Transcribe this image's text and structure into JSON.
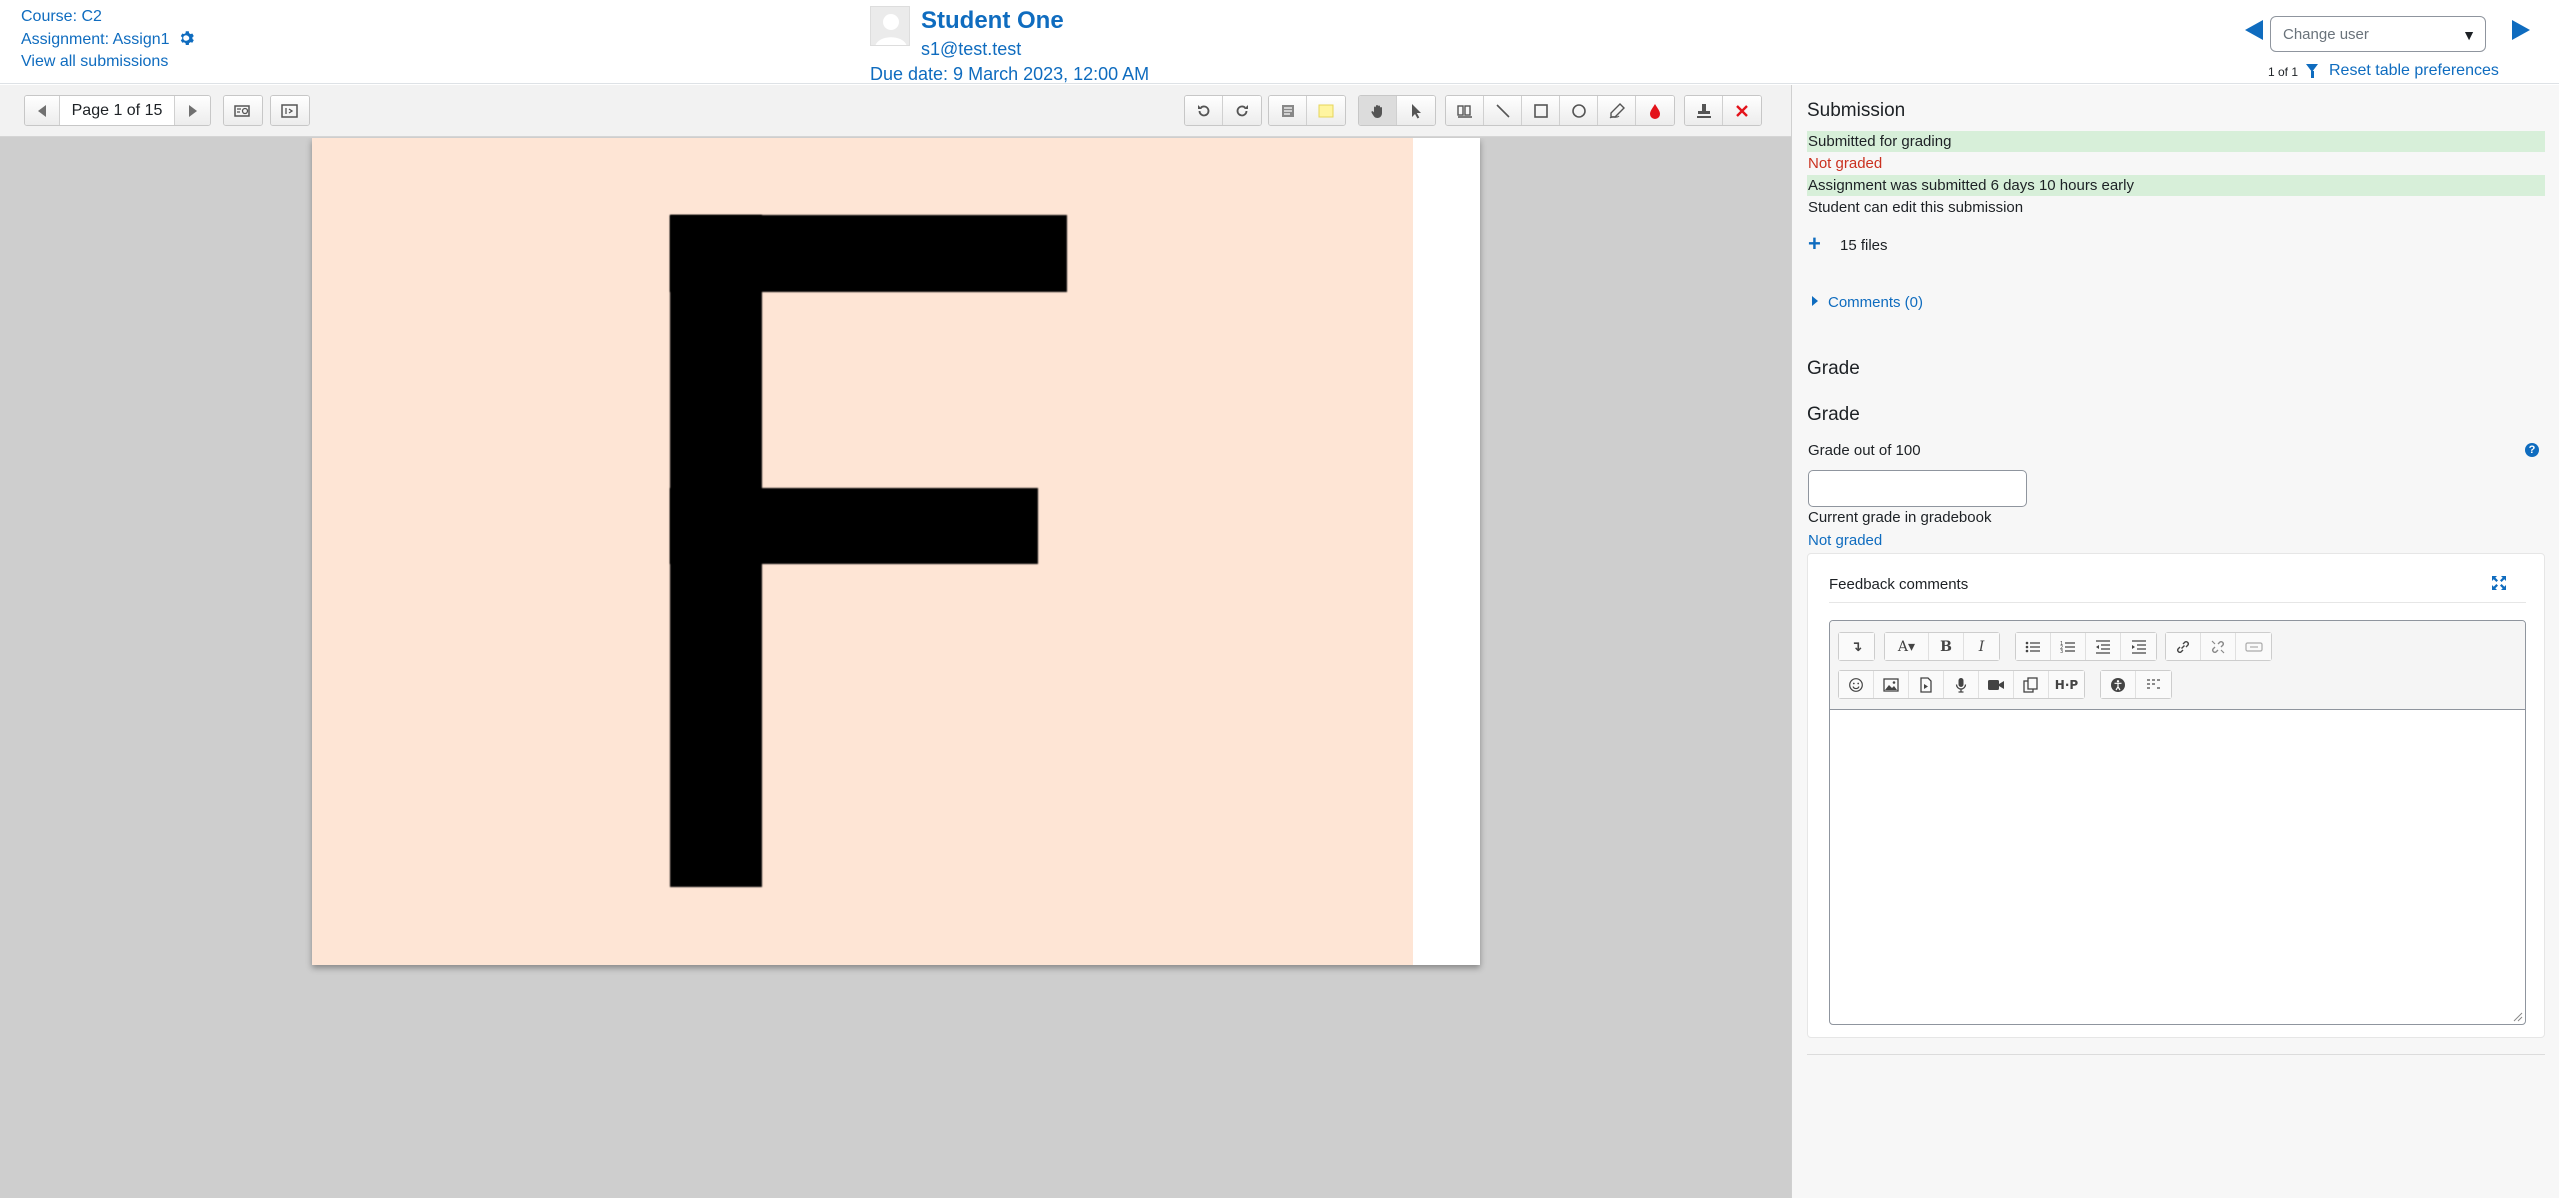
{
  "header": {
    "course_link": "Course: C2",
    "assignment_link": "Assignment: Assign1",
    "view_all_link": "View all submissions",
    "student_name": "Student One",
    "student_email": "s1@test.test",
    "due_date": "Due date: 9 March 2023, 12:00 AM",
    "change_user_placeholder": "Change user",
    "user_count": "1 of 1",
    "reset_preferences": "Reset table preferences"
  },
  "editor": {
    "page_select": "Page 1 of 15",
    "document_letter": "F"
  },
  "panel": {
    "submission_heading": "Submission",
    "status_submitted": "Submitted for grading",
    "status_grading": "Not graded",
    "status_timing": "Assignment was submitted 6 days 10 hours early",
    "status_editable": "Student can edit this submission",
    "files_label": "15 files",
    "comments_label": "Comments (0)",
    "grade_heading_1": "Grade",
    "grade_heading_2": "Grade",
    "grade_out_of": "Grade out of 100",
    "grade_value": "",
    "current_grade_label": "Current grade in gradebook",
    "current_grade_value": "Not graded",
    "feedback_title": "Feedback comments",
    "feedback_text": ""
  },
  "colors": {
    "link_blue": "#0f6cbf",
    "status_green_bg": "#d7efd9",
    "status_red": "#ca3120",
    "pdf_background": "#fee5d5"
  }
}
